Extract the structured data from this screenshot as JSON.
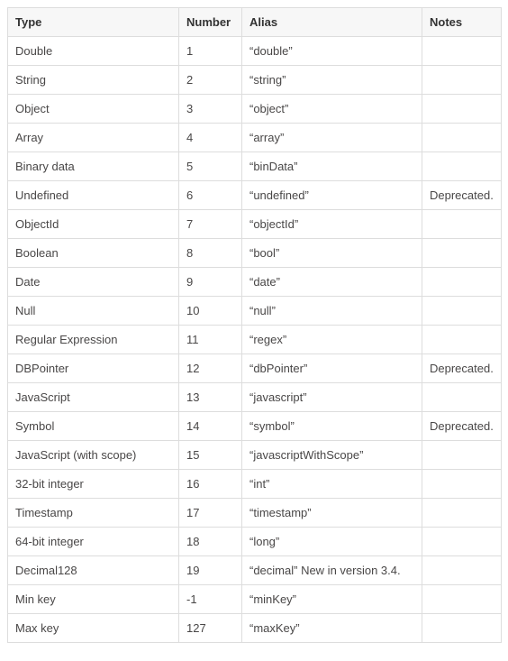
{
  "headers": {
    "type": "Type",
    "number": "Number",
    "alias": "Alias",
    "notes": "Notes"
  },
  "rows": [
    {
      "type": "Double",
      "number": "1",
      "alias": "“double”",
      "notes": ""
    },
    {
      "type": "String",
      "number": "2",
      "alias": "“string”",
      "notes": ""
    },
    {
      "type": "Object",
      "number": "3",
      "alias": "“object”",
      "notes": ""
    },
    {
      "type": "Array",
      "number": "4",
      "alias": "“array”",
      "notes": ""
    },
    {
      "type": "Binary data",
      "number": "5",
      "alias": "“binData”",
      "notes": ""
    },
    {
      "type": "Undefined",
      "number": "6",
      "alias": "“undefined”",
      "notes": "Deprecated."
    },
    {
      "type": "ObjectId",
      "number": "7",
      "alias": "“objectId”",
      "notes": ""
    },
    {
      "type": "Boolean",
      "number": "8",
      "alias": "“bool”",
      "notes": ""
    },
    {
      "type": "Date",
      "number": "9",
      "alias": "“date”",
      "notes": ""
    },
    {
      "type": "Null",
      "number": "10",
      "alias": "“null”",
      "notes": ""
    },
    {
      "type": "Regular Expression",
      "number": "11",
      "alias": "“regex”",
      "notes": ""
    },
    {
      "type": "DBPointer",
      "number": "12",
      "alias": "“dbPointer”",
      "notes": "Deprecated."
    },
    {
      "type": "JavaScript",
      "number": "13",
      "alias": "“javascript”",
      "notes": ""
    },
    {
      "type": "Symbol",
      "number": "14",
      "alias": "“symbol”",
      "notes": "Deprecated."
    },
    {
      "type": "JavaScript (with scope)",
      "number": "15",
      "alias": "“javascriptWithScope”",
      "notes": ""
    },
    {
      "type": "32-bit integer",
      "number": "16",
      "alias": "“int”",
      "notes": ""
    },
    {
      "type": "Timestamp",
      "number": "17",
      "alias": "“timestamp”",
      "notes": ""
    },
    {
      "type": "64-bit integer",
      "number": "18",
      "alias": "“long”",
      "notes": ""
    },
    {
      "type": "Decimal128",
      "number": "19",
      "alias": "“decimal” New in version 3.4.",
      "notes": ""
    },
    {
      "type": "Min key",
      "number": "-1",
      "alias": "“minKey”",
      "notes": ""
    },
    {
      "type": "Max key",
      "number": "127",
      "alias": "“maxKey”",
      "notes": ""
    }
  ]
}
